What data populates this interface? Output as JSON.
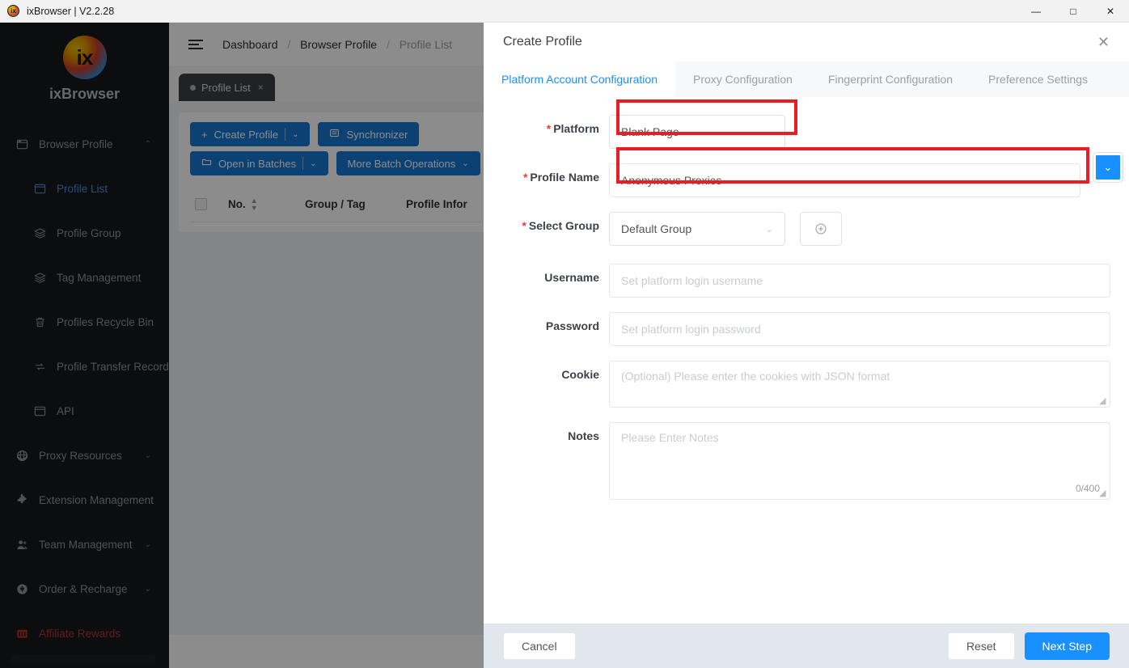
{
  "window": {
    "title": "ixBrowser | V2.2.28",
    "logo_icon": "ixbrowser-logo-icon",
    "minimize": "—",
    "maximize": "□",
    "close": "✕"
  },
  "sidebar": {
    "brand_mark": "ix",
    "brand_name": "ixBrowser",
    "scroll_handle": "horizontal-scrollbar",
    "items": [
      {
        "label": "Browser Profile",
        "icon": "window-icon",
        "chevron": "⌃",
        "level": "top",
        "state": "expanded"
      },
      {
        "label": "Profile List",
        "icon": "window-icon",
        "level": "sub",
        "state": "active"
      },
      {
        "label": "Profile Group",
        "icon": "layers-icon",
        "level": "sub"
      },
      {
        "label": "Tag Management",
        "icon": "layers-icon",
        "level": "sub"
      },
      {
        "label": "Profiles Recycle Bin",
        "icon": "trash-icon",
        "level": "sub"
      },
      {
        "label": "Profile Transfer Record",
        "icon": "transfer-icon",
        "level": "sub"
      },
      {
        "label": "API",
        "icon": "window-icon",
        "level": "sub"
      },
      {
        "label": "Proxy Resources",
        "icon": "globe-icon",
        "chevron": "⌄",
        "level": "top"
      },
      {
        "label": "Extension Management",
        "icon": "puzzle-icon",
        "level": "top"
      },
      {
        "label": "Team Management",
        "icon": "users-icon",
        "chevron": "⌄",
        "level": "top"
      },
      {
        "label": "Order & Recharge",
        "icon": "coin-icon",
        "chevron": "⌄",
        "level": "top"
      },
      {
        "label": "Affiliate Rewards",
        "icon": "chart-icon",
        "level": "top",
        "state": "affiliate"
      }
    ]
  },
  "app": {
    "menu_icon": "hamburger-icon",
    "breadcrumbs": [
      "Dashboard",
      "Browser Profile",
      "Profile List"
    ],
    "breadcrumb_separator": "/",
    "tab": {
      "label": "Profile List",
      "close": "×"
    },
    "toolbar": {
      "create_profile": "Create Profile",
      "create_profile_prefix": "+",
      "synchronizer": "Synchronizer",
      "synchronizer_icon": "sync-icon",
      "open_in_batches": "Open in Batches",
      "open_in_batches_icon": "folder-icon",
      "more_batch_operations": "More Batch Operations",
      "caret": "⌄"
    },
    "table_headers": {
      "select_all": "select-all-checkbox",
      "no": "No.",
      "sort": "↕",
      "group_tag": "Group / Tag",
      "profile_info": "Profile Infor"
    }
  },
  "modal": {
    "title": "Create Profile",
    "close_icon": "✕",
    "tabs": [
      {
        "label": "Platform Account Configuration",
        "active": true
      },
      {
        "label": "Proxy Configuration",
        "active": false
      },
      {
        "label": "Fingerprint Configuration",
        "active": false
      },
      {
        "label": "Preference Settings",
        "active": false
      }
    ],
    "fields": {
      "platform": {
        "label": "Platform",
        "required": true,
        "value": "Blank Page",
        "arrow": "⌄"
      },
      "profile_name": {
        "label": "Profile Name",
        "required": true,
        "value": "Anonymous Proxies",
        "dropdown_icon": "⌄"
      },
      "select_group": {
        "label": "Select Group",
        "required": true,
        "value": "Default Group",
        "arrow": "⌄",
        "add_icon": "⊕"
      },
      "username": {
        "label": "Username",
        "required": false,
        "value": "",
        "placeholder": "Set platform login username"
      },
      "password": {
        "label": "Password",
        "required": false,
        "value": "",
        "placeholder": "Set platform login password"
      },
      "cookie": {
        "label": "Cookie",
        "required": false,
        "value": "",
        "placeholder": "(Optional) Please enter the cookies with JSON format"
      },
      "notes": {
        "label": "Notes",
        "required": false,
        "value": "",
        "placeholder": "Please Enter Notes",
        "counter": "0/400"
      }
    },
    "footer": {
      "cancel": "Cancel",
      "reset": "Reset",
      "next": "Next Step"
    }
  },
  "annotations": {
    "highlight_color": "#ea1d25",
    "boxes": [
      "platform-field-highlight",
      "profile-name-field-highlight"
    ]
  },
  "colors": {
    "accent": "#1890ff",
    "sidebar_bg": "#15181d",
    "required_star": "#e8413a",
    "annotation": "#ea1d25"
  }
}
